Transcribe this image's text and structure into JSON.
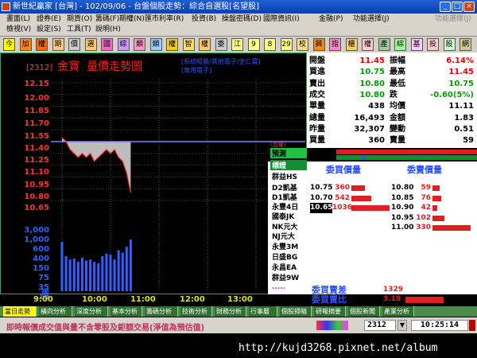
{
  "window": {
    "title": "新世紀贏家 [台灣] - 102/09/06 - 台盤個股走勢：綜合自選股[名望股]"
  },
  "menu": {
    "row1": [
      "畫面(L)",
      "證券(E)",
      "期貨(O)",
      "籌碼(F)",
      "期權(N)",
      "匯市利率(R)",
      "投資(B)",
      "操盤密碼(D)",
      "國際資訊(I)",
      "金融(P)",
      "功能選擇(J)",
      "功能選擇(J)"
    ],
    "row2": [
      "檢視(V)",
      "設定(S)",
      "工具(T)",
      "說明(H)"
    ]
  },
  "toolbar": [
    "今",
    "加",
    "權",
    "期",
    "價",
    "選",
    "國",
    "綜",
    "類",
    "類",
    "權",
    "智",
    "權",
    "委",
    "江",
    "9",
    "8",
    "29",
    "校",
    "興",
    "指",
    "櫃",
    "權",
    "產",
    "綜",
    "基",
    "投",
    "股",
    "網"
  ],
  "chart": {
    "code": "[2312]",
    "name": "金寶",
    "title": "量價走勢圖",
    "tags": [
      "[系統組裝/其他電子/金仁寶]",
      "[車用電子]"
    ],
    "price_labels": [
      "12.15",
      "12.00",
      "11.85",
      "11.70",
      "11.55",
      "11.40",
      "11.25",
      "11.10",
      "10.95",
      "10.80",
      "10.65"
    ],
    "vol_labels": [
      "3,000",
      "1,000",
      "600",
      "400",
      "150",
      "75",
      "35",
      "15"
    ],
    "vol_unit": "張",
    "time_labels": [
      "9:00",
      "10:00",
      "11:00",
      "12:00",
      "13:00"
    ],
    "ref_label": "(加權)"
  },
  "chart_data": {
    "type": "line",
    "title": "量價走勢圖",
    "x_range": [
      "9:00",
      "13:30"
    ],
    "ylim": [
      10.65,
      12.15
    ],
    "reference": 11.4,
    "series": [
      {
        "name": "價",
        "times": [
          "9:00",
          "9:05",
          "9:10",
          "9:15",
          "9:20",
          "9:25",
          "9:30",
          "9:35",
          "9:40",
          "9:45",
          "9:50",
          "9:55",
          "10:00",
          "10:05",
          "10:10",
          "10:15",
          "10:20",
          "10:25"
        ],
        "values": [
          11.45,
          11.4,
          11.3,
          11.25,
          11.2,
          11.25,
          11.2,
          11.25,
          11.15,
          11.2,
          11.25,
          11.3,
          11.25,
          11.3,
          11.2,
          11.15,
          11.0,
          10.75
        ]
      },
      {
        "name": "量",
        "times": [
          "9:00",
          "9:05",
          "9:10",
          "9:15",
          "9:20",
          "9:25",
          "9:30",
          "9:35",
          "9:40",
          "9:45",
          "9:50",
          "9:55",
          "10:00",
          "10:05",
          "10:10",
          "10:15",
          "10:20",
          "10:25"
        ],
        "values": [
          320,
          60,
          40,
          45,
          30,
          50,
          35,
          40,
          30,
          25,
          60,
          80,
          70,
          40,
          120,
          90,
          180,
          420
        ]
      }
    ]
  },
  "quote": {
    "left": [
      [
        "開盤",
        "11.45"
      ],
      [
        "買進",
        "10.75"
      ],
      [
        "賣出",
        "10.80"
      ],
      [
        "成交",
        "10.80"
      ],
      [
        "單量",
        "438"
      ],
      [
        "總量",
        "16,493"
      ],
      [
        "昨量",
        "32,307"
      ],
      [
        "買量",
        "360"
      ]
    ],
    "right": [
      [
        "振幅",
        "6.14%"
      ],
      [
        "最高",
        "11.45"
      ],
      [
        "最低",
        "10.75"
      ],
      [
        "跌",
        "-0.60(5%)"
      ],
      [
        "均價",
        "11.11"
      ],
      [
        "金額",
        "1.83"
      ],
      [
        "變動",
        "0.51"
      ],
      [
        "賣量",
        "59"
      ]
    ]
  },
  "strategy": [
    "預測",
    "標證",
    "群益HS",
    "D2凱基",
    "D1凱基",
    "永豐4日",
    "國泰JK",
    "NK元大",
    "NJ元大",
    "永豐3M",
    "日盛BG",
    "永昌EA",
    "群益9W",
    "....."
  ],
  "depth": {
    "bid_header": "委買價量",
    "ask_header": "委賣價量",
    "bids": [
      [
        "10.75",
        "360"
      ],
      [
        "10.70",
        "542"
      ],
      [
        "10.65",
        "1036"
      ]
    ],
    "asks": [
      [
        "10.80",
        "59"
      ],
      [
        "10.85",
        "76"
      ],
      [
        "10.90",
        "42"
      ],
      [
        "10.95",
        "102"
      ],
      [
        "11.00",
        "330"
      ]
    ],
    "diff_label": "委買賣差",
    "diff_value": "1329",
    "ratio_label": "委買賣比",
    "ratio_value": "3.18"
  },
  "tabs": [
    "當日走勢",
    "橫向分析",
    "深度分析",
    "基本分析",
    "籌碼分析",
    "技術分析",
    "財務分析",
    "行事曆",
    "個股掃瞄",
    "研報摘要",
    "個股新聞",
    "產業分析"
  ],
  "status": {
    "marquee": "即時報價成交值與量不含零股及鉅額交易(淨值為預估值)",
    "code": "2312",
    "time": "10:25:14"
  },
  "watermark": "http://kujd3268.pixnet.net/album",
  "colors": {
    "up": "#ff2020",
    "down": "#00c000",
    "volume": "#3060ff",
    "price": "#ff3030"
  }
}
